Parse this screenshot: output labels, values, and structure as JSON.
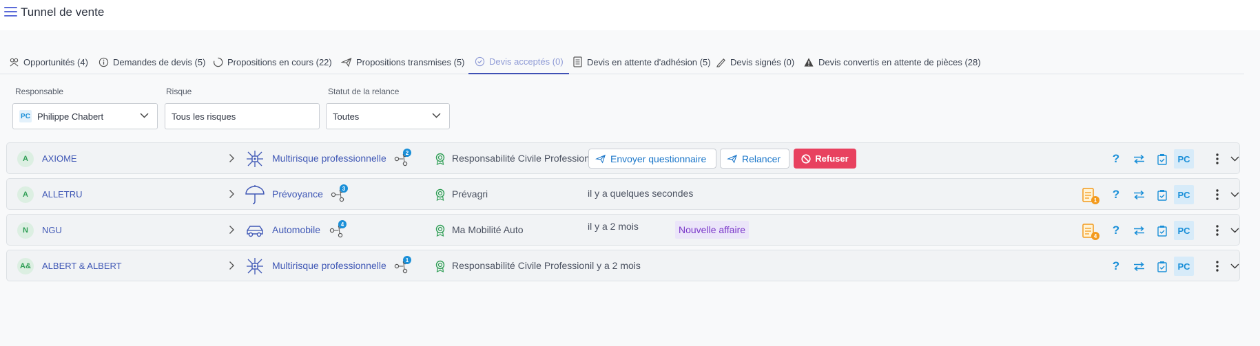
{
  "app": {
    "title": "Tunnel de vente"
  },
  "tabs": [
    {
      "label": "Opportunités (4)",
      "icon": "people-network-icon"
    },
    {
      "label": "Demandes de devis (5)",
      "icon": "info-circle-icon"
    },
    {
      "label": "Propositions en cours (22)",
      "icon": "loading-circle-icon"
    },
    {
      "label": "Propositions transmises (5)",
      "icon": "paper-plane-icon"
    },
    {
      "label": "Devis acceptés (0)",
      "icon": "check-circle-icon",
      "active": true
    },
    {
      "label": "Devis en attente d'adhésion (5)",
      "icon": "document-icon"
    },
    {
      "label": "Devis signés (0)",
      "icon": "signature-pen-icon"
    },
    {
      "label": "Devis convertis en attente de pièces (28)",
      "icon": "warning-triangle-icon"
    }
  ],
  "filters": {
    "responsable": {
      "label": "Responsable",
      "initials": "PC",
      "value": "Philippe Chabert"
    },
    "risque": {
      "label": "Risque",
      "value": "Tous les risques"
    },
    "relance": {
      "label": "Statut de la relance",
      "value": "Toutes"
    }
  },
  "actions": {
    "envoyer": "Envoyer questionnaire",
    "relancer": "Relancer",
    "refuser": "Refuser",
    "help": "?",
    "owner_initials": "PC"
  },
  "rows": [
    {
      "initials": "A",
      "company": "AXIOME",
      "product": "Multirisque professionnelle",
      "product_icon": "network-hub-icon",
      "contacts": "2",
      "guarantee": "Responsabilité Civile Profession",
      "time": "",
      "badge": "",
      "docs": ""
    },
    {
      "initials": "A",
      "company": "ALLETRU",
      "product": "Prévoyance",
      "product_icon": "umbrella-icon",
      "contacts": "3",
      "guarantee": "Prévagri",
      "time": "il y a quelques secondes",
      "badge": "",
      "docs": "1"
    },
    {
      "initials": "N",
      "company": "NGU",
      "product": "Automobile",
      "product_icon": "car-icon",
      "contacts": "4",
      "guarantee": "Ma Mobilité Auto",
      "time": "il y a 2 mois",
      "badge": "Nouvelle affaire",
      "docs": "4"
    },
    {
      "initials": "A&",
      "company": "ALBERT & ALBERT",
      "product": "Multirisque professionnelle",
      "product_icon": "network-hub-icon",
      "contacts": "1",
      "guarantee": "Responsabilité Civile Professionil y a 2 mois",
      "time": "",
      "badge": "",
      "docs": ""
    }
  ],
  "colors": {
    "accent": "#3f51b5",
    "link": "#3f57b5",
    "refuse": "#e8415f",
    "badge_bg": "#ebe5f9",
    "badge_text": "#7a36c9"
  }
}
